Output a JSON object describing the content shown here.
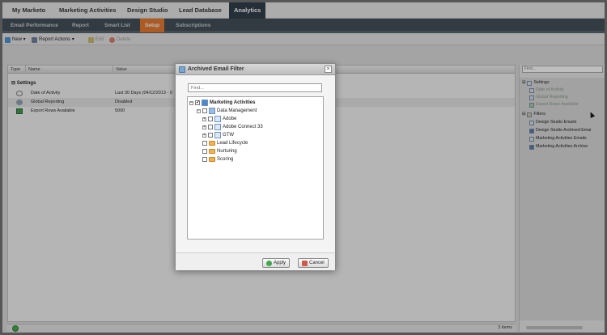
{
  "top_nav": {
    "tabs": [
      {
        "label": "My Marketo"
      },
      {
        "label": "Marketing Activities"
      },
      {
        "label": "Design Studio"
      },
      {
        "label": "Lead Database"
      },
      {
        "label": "Analytics"
      }
    ]
  },
  "sub_tabs": [
    {
      "label": "Email Performance"
    },
    {
      "label": "Report"
    },
    {
      "label": "Smart List"
    },
    {
      "label": "Setup"
    },
    {
      "label": "Subscriptions"
    }
  ],
  "toolbar": {
    "new_label": "New ▾",
    "report_actions_label": "Report Actions ▾",
    "edit_label": "Edit",
    "delete_label": "Delete"
  },
  "grid": {
    "columns": [
      "Type",
      "Name",
      "Value"
    ],
    "group_label": "Settings",
    "rows": [
      {
        "name": "Date of Activity",
        "value": "Last 30 Days (04/12/2013 - 0"
      },
      {
        "name": "Global Reporting",
        "value": "Disabled"
      },
      {
        "name": "Export Rows Available",
        "value": "5000"
      }
    ],
    "status_count": "3 items"
  },
  "right_panel": {
    "find_placeholder": "Find...",
    "settings_label": "Settings",
    "settings_items": [
      "Date of Activity",
      "Global Reporting",
      "Export Rows Available"
    ],
    "filters_label": "Filters",
    "filter_items": [
      "Design Studio Emails",
      "Design Studio Archived Emai",
      "Marketing Activities Emails",
      "Marketing Activities Archive"
    ]
  },
  "dialog": {
    "title": "Archived Email Filter",
    "find_placeholder": "Find...",
    "tree": {
      "root_label": "Marketing Activities",
      "data_management_label": "Data Management",
      "programs": [
        "Adobe",
        "Adobe Connect 33",
        "GTW"
      ],
      "folders": [
        "Lead Lifecycle",
        "Nurturing",
        "Scoring"
      ]
    },
    "apply_label": "Apply",
    "cancel_label": "Cancel"
  },
  "colors": {
    "active_tab": "#2c3a44",
    "subtab_active": "#e7762c",
    "folder": "#f2b24c"
  }
}
